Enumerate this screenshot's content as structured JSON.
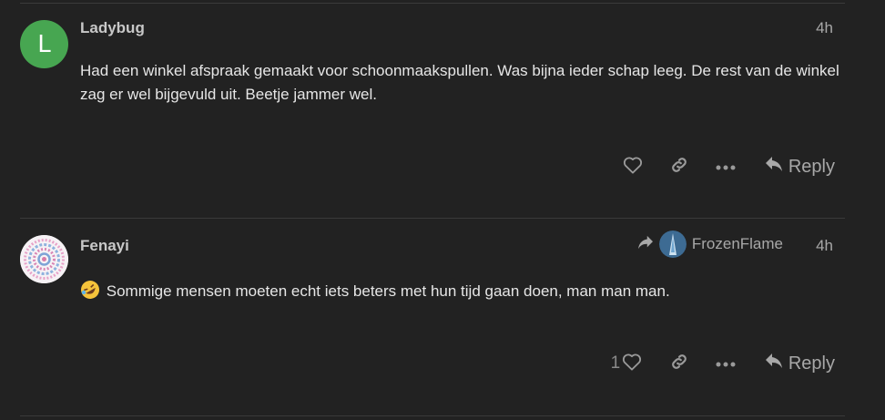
{
  "posts": [
    {
      "username": "Ladybug",
      "avatar_letter": "L",
      "avatar_color": "#47a651",
      "age": "4h",
      "body": "Had een winkel afspraak gemaakt voor schoonmaakspullen. Was bijna ieder schap leeg. De rest van de winkel zag er wel bijgevuld uit. Beetje jammer wel.",
      "like_count": "",
      "reply_label": "Reply"
    },
    {
      "username": "Fenayi",
      "age": "4h",
      "emoji": "🤣",
      "body": "Sommige mensen moeten echt iets beters met hun tijd gaan doen, man man man.",
      "reply_to_user": "FrozenFlame",
      "like_count": "1",
      "reply_label": "Reply"
    }
  ],
  "icons": {
    "like": "heart-icon",
    "link": "link-icon",
    "more": "ellipsis-icon",
    "reply": "reply-arrow-icon",
    "reply_to": "share-arrow-icon"
  }
}
